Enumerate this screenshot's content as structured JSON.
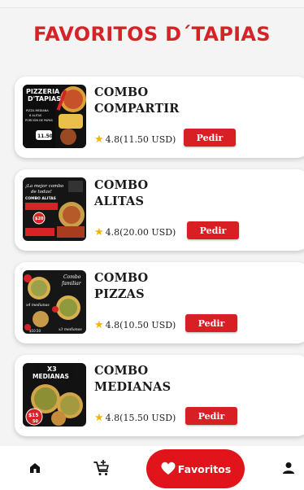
{
  "page": {
    "title": "FAVORITOS D´TAPIAS"
  },
  "favorites": [
    {
      "name_line1": "COMBO",
      "name_line2": "COMPARTIR",
      "rating": "4.8(11.50 USD)",
      "button": "Pedir",
      "thumb_text": [
        "PIZZERIA",
        "D'TAPIAS",
        "PIZZA MEDIANA",
        "6 ALITAS",
        "PORCIÓN DE PAPAS",
        "11.50"
      ]
    },
    {
      "name_line1": "COMBO",
      "name_line2": "ALITAS",
      "rating": "4.8(20.00 USD)",
      "button": "Pedir",
      "thumb_text": [
        "¡La mejor combo",
        "de todas!",
        "COMBO ALITAS",
        "$20"
      ]
    },
    {
      "name_line1": "COMBO",
      "name_line2": "PIZZAS",
      "rating": "4.8(10.50 USD)",
      "button": "Pedir",
      "thumb_text": [
        "Combo",
        "familiar",
        "x4 medianas",
        "x3 medianas",
        "$10.50"
      ]
    },
    {
      "name_line1": "COMBO",
      "name_line2": "MEDIANAS",
      "rating": "4.8(15.50 USD)",
      "button": "Pedir",
      "thumb_text": [
        "X3",
        "MEDIANAS",
        "$15",
        "50"
      ]
    }
  ],
  "nav": {
    "home_icon": "home-icon",
    "cart_icon": "cart-add-icon",
    "favorites_label": "Favoritos",
    "favorites_icon": "heart-icon",
    "profile_icon": "person-icon"
  },
  "colors": {
    "accent": "#d62327",
    "button": "#d71f24",
    "pill": "#e0141a",
    "star": "#f4b400"
  }
}
